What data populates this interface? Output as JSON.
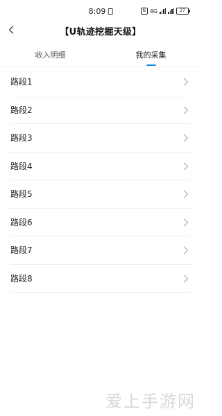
{
  "status": {
    "time": "8:09",
    "network_label": "4G",
    "battery_level": "27"
  },
  "header": {
    "title": "【U轨迹挖掘天级】"
  },
  "tabs": [
    {
      "label": "收入明细",
      "active": false
    },
    {
      "label": "我的采集",
      "active": true
    }
  ],
  "accent_color": "#1e88e5",
  "list": {
    "items": [
      {
        "label": "路段1"
      },
      {
        "label": "路段2"
      },
      {
        "label": "路段3"
      },
      {
        "label": "路段4"
      },
      {
        "label": "路段5"
      },
      {
        "label": "路段6"
      },
      {
        "label": "路段7"
      },
      {
        "label": "路段8"
      }
    ]
  },
  "watermark": "爱上手游网"
}
